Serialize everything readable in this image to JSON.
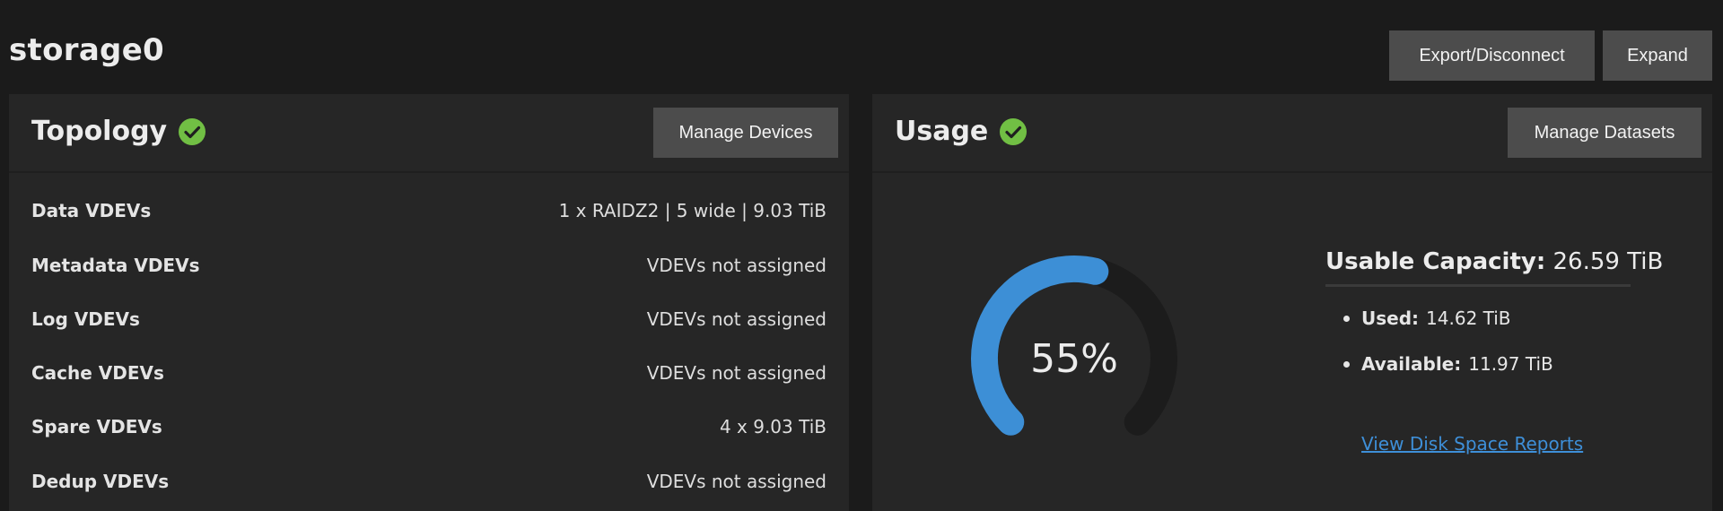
{
  "pool": {
    "name": "storage0",
    "export_label": "Export/Disconnect",
    "expand_label": "Expand"
  },
  "topology": {
    "title": "Topology",
    "manage_label": "Manage Devices",
    "rows": [
      {
        "label": "Data VDEVs",
        "value": "1 x RAIDZ2 | 5 wide | 9.03 TiB"
      },
      {
        "label": "Metadata VDEVs",
        "value": "VDEVs not assigned"
      },
      {
        "label": "Log VDEVs",
        "value": "VDEVs not assigned"
      },
      {
        "label": "Cache VDEVs",
        "value": "VDEVs not assigned"
      },
      {
        "label": "Spare VDEVs",
        "value": "4 x 9.03 TiB"
      },
      {
        "label": "Dedup VDEVs",
        "value": "VDEVs not assigned"
      }
    ]
  },
  "usage": {
    "title": "Usage",
    "manage_label": "Manage Datasets",
    "percent": 55,
    "percent_text": "55%",
    "capacity_label": "Usable Capacity:",
    "capacity_value": "26.59 TiB",
    "used_label": "Used:",
    "used_value": "14.62 TiB",
    "available_label": "Available:",
    "available_value": "11.97 TiB",
    "reports_link": "View Disk Space Reports"
  },
  "colors": {
    "status_ok": "#71bf44",
    "gauge_fill": "#3d8fd6",
    "gauge_track": "#1c1c1c",
    "link": "#3e8fd8"
  },
  "icons": {
    "topology_status": "check-circle-icon",
    "usage_status": "check-circle-icon"
  }
}
